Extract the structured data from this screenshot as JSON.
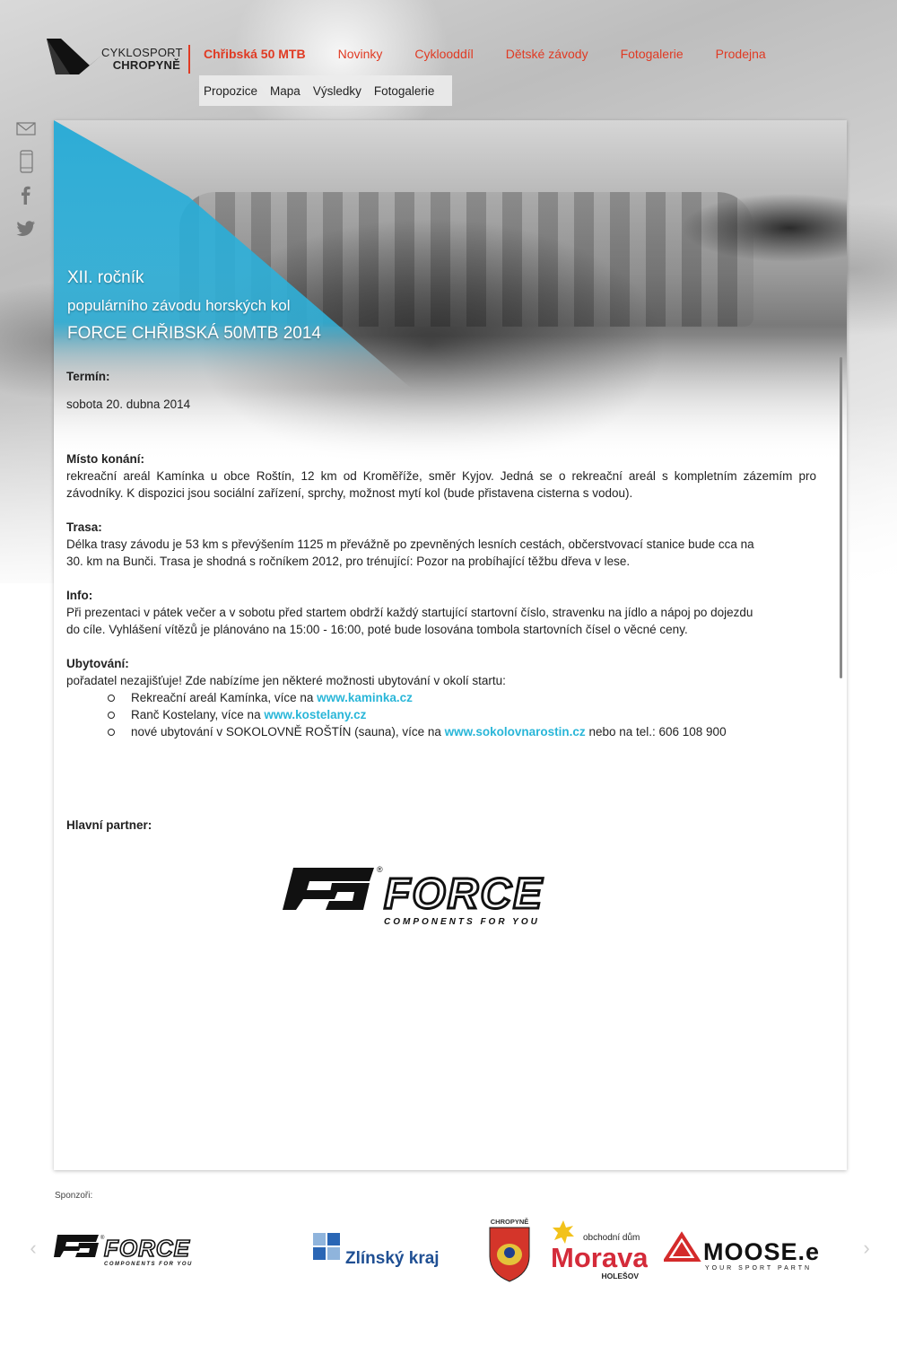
{
  "header": {
    "logo_line1": "CYKLOSPORT",
    "logo_line2": "CHROPYNĚ",
    "nav": [
      {
        "label": "Chřibská 50 MTB",
        "active": true
      },
      {
        "label": "Novinky",
        "active": false
      },
      {
        "label": "Cyklooddíl",
        "active": false
      },
      {
        "label": "Dětské závody",
        "active": false
      },
      {
        "label": "Fotogalerie",
        "active": false
      },
      {
        "label": "Prodejna",
        "active": false
      }
    ],
    "subnav": [
      "Propozice",
      "Mapa",
      "Výsledky",
      "Fotogalerie"
    ]
  },
  "side_icons": [
    "mail-icon",
    "phone-icon",
    "facebook-icon",
    "twitter-icon"
  ],
  "hero": {
    "line1": "XII. ročník",
    "line2": "populárního závodu horských kol",
    "line3": "FORCE CHŘIBSKÁ 50MTB 2014"
  },
  "content": {
    "term_label": "Termín:",
    "term_value": "sobota 20. dubna 2014",
    "place_label": "Místo konání:",
    "place_text": "rekreační areál Kamínka u obce Roštín, 12 km od Kroměříže, směr Kyjov. Jedná se o rekreační areál s kompletním zázemím pro závodníky. K dispozici jsou sociální zařízení, sprchy, možnost mytí kol (bude přistavena cisterna s vodou).",
    "track_label": "Trasa:",
    "track_text_1": "Délka trasy závodu je 53 km s převýšením 1125 m převážně po zpevněných lesních cestách, občerstvovací stanice bude cca na",
    "track_text_2": "30. km na Bunči. Trasa je shodná s ročníkem 2012, pro trénující: Pozor na probíhající těžbu dřeva v lese.",
    "info_label": "Info:",
    "info_text_1": "Při prezentaci v pátek večer a v sobotu před startem obdrží každý startující startovní číslo, stravenku na jídlo a nápoj po dojezdu",
    "info_text_2": "do cíle. Vyhlášení vítězů je plánováno na 15:00 - 16:00, poté bude losována tombola startovních čísel o věcné ceny.",
    "lodging_label": "Ubytování:",
    "lodging_text": "pořadatel nezajišťuje! Zde nabízíme jen některé možnosti ubytování v okolí startu:",
    "lodging_items": [
      {
        "pre": "Rekreační areál Kamínka, více na ",
        "link": "www.kaminka.cz",
        "post": ""
      },
      {
        "pre": "Ranč Kostelany, více na ",
        "link": "www.kostelany.cz",
        "post": ""
      },
      {
        "pre": "nové ubytování v SOKOLOVNĚ ROŠTÍN (sauna), více na ",
        "link": "www.sokolovnarostin.cz",
        "post": " nebo na tel.: 606 108 900"
      }
    ],
    "partner_label": "Hlavní partner:"
  },
  "partner": {
    "name": "FORCE",
    "tagline": "COMPONENTS FOR YOU"
  },
  "sponsors": {
    "label": "Sponzoři:",
    "items": [
      {
        "name": "FORCE",
        "tagline": "COMPONENTS FOR YOU"
      },
      {
        "name": "Zlínský kraj"
      },
      {
        "name": "CHROPYNĚ"
      },
      {
        "name_top": "obchodní dům",
        "name": "Morava",
        "sub": "HOLEŠOV"
      },
      {
        "name": "MOOSE.e",
        "tagline": "YOUR SPORT PARTN"
      }
    ]
  },
  "colors": {
    "accent": "#e03a23",
    "link": "#29b6d8",
    "hero_blue": "#1ea8d6"
  }
}
